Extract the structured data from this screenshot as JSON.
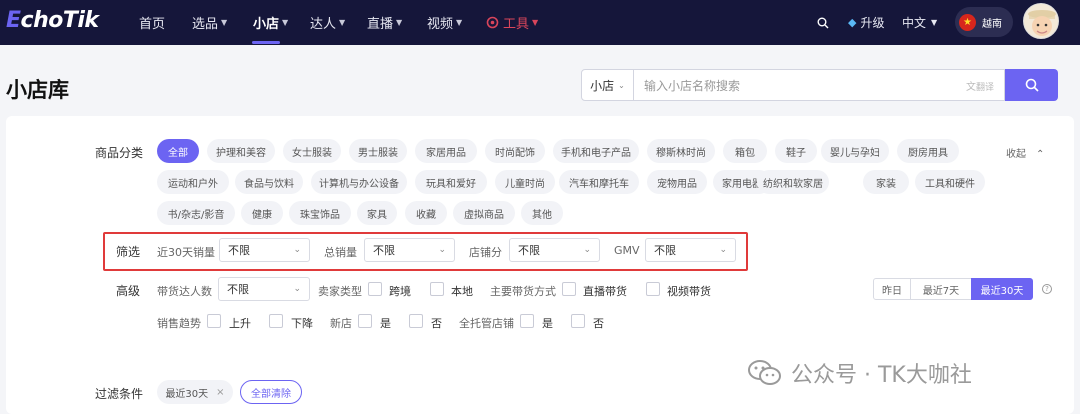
{
  "brand": {
    "logo_e": "E",
    "logo_rest": "choTik"
  },
  "nav": {
    "items": [
      "首页",
      "选品",
      "小店",
      "达人",
      "直播",
      "视频",
      "工具"
    ],
    "active": "小店"
  },
  "right": {
    "upgrade": "升级",
    "lang": "中文",
    "country": "越南"
  },
  "page": {
    "title": "小店库"
  },
  "search": {
    "scope": "小店",
    "placeholder": "输入小店名称搜索",
    "translate": "翻译"
  },
  "filters": {
    "category_label": "商品分类",
    "categories": [
      "全部",
      "护理和美容",
      "女士服装",
      "男士服装",
      "家居用品",
      "时尚配饰",
      "手机和电子产品",
      "穆斯林时尚",
      "箱包",
      "鞋子",
      "婴儿与孕妇",
      "厨房用具",
      "运动和户外",
      "食品与饮料",
      "计算机与办公设备",
      "玩具和爱好",
      "儿童时尚",
      "汽车和摩托车",
      "宠物用品",
      "家用电器",
      "纺织和软家居",
      "家装",
      "工具和硬件",
      "书/杂志/影音",
      "健康",
      "珠宝饰品",
      "家具",
      "收藏",
      "虚拟商品",
      "其他"
    ],
    "collapse": "收起",
    "screen_label": "筛选",
    "screen": [
      {
        "label": "近30天销量",
        "value": "不限"
      },
      {
        "label": "总销量",
        "value": "不限"
      },
      {
        "label": "店铺分",
        "value": "不限"
      },
      {
        "label": "GMV",
        "value": "不限"
      }
    ],
    "advanced_label": "高级",
    "influencers_label": "带货达人数",
    "influencers_value": "不限",
    "seller_type_label": "卖家类型",
    "seller_types": [
      "跨境",
      "本地"
    ],
    "method_label": "主要带货方式",
    "methods": [
      "直播带货",
      "视频带货"
    ],
    "trend_label": "销售趋势",
    "trends": [
      "上升",
      "下降"
    ],
    "new_label": "新店",
    "new_opts": [
      "是",
      "否"
    ],
    "managed_label": "全托管店铺",
    "managed_opts": [
      "是",
      "否"
    ],
    "ranges": [
      "昨日",
      "最近7天",
      "最近30天"
    ],
    "active_range": "最近30天",
    "filter_label": "过滤条件",
    "filter_tag": "最近30天",
    "clear_all": "全部清除"
  },
  "watermark": "公众号 · TK大咖社"
}
